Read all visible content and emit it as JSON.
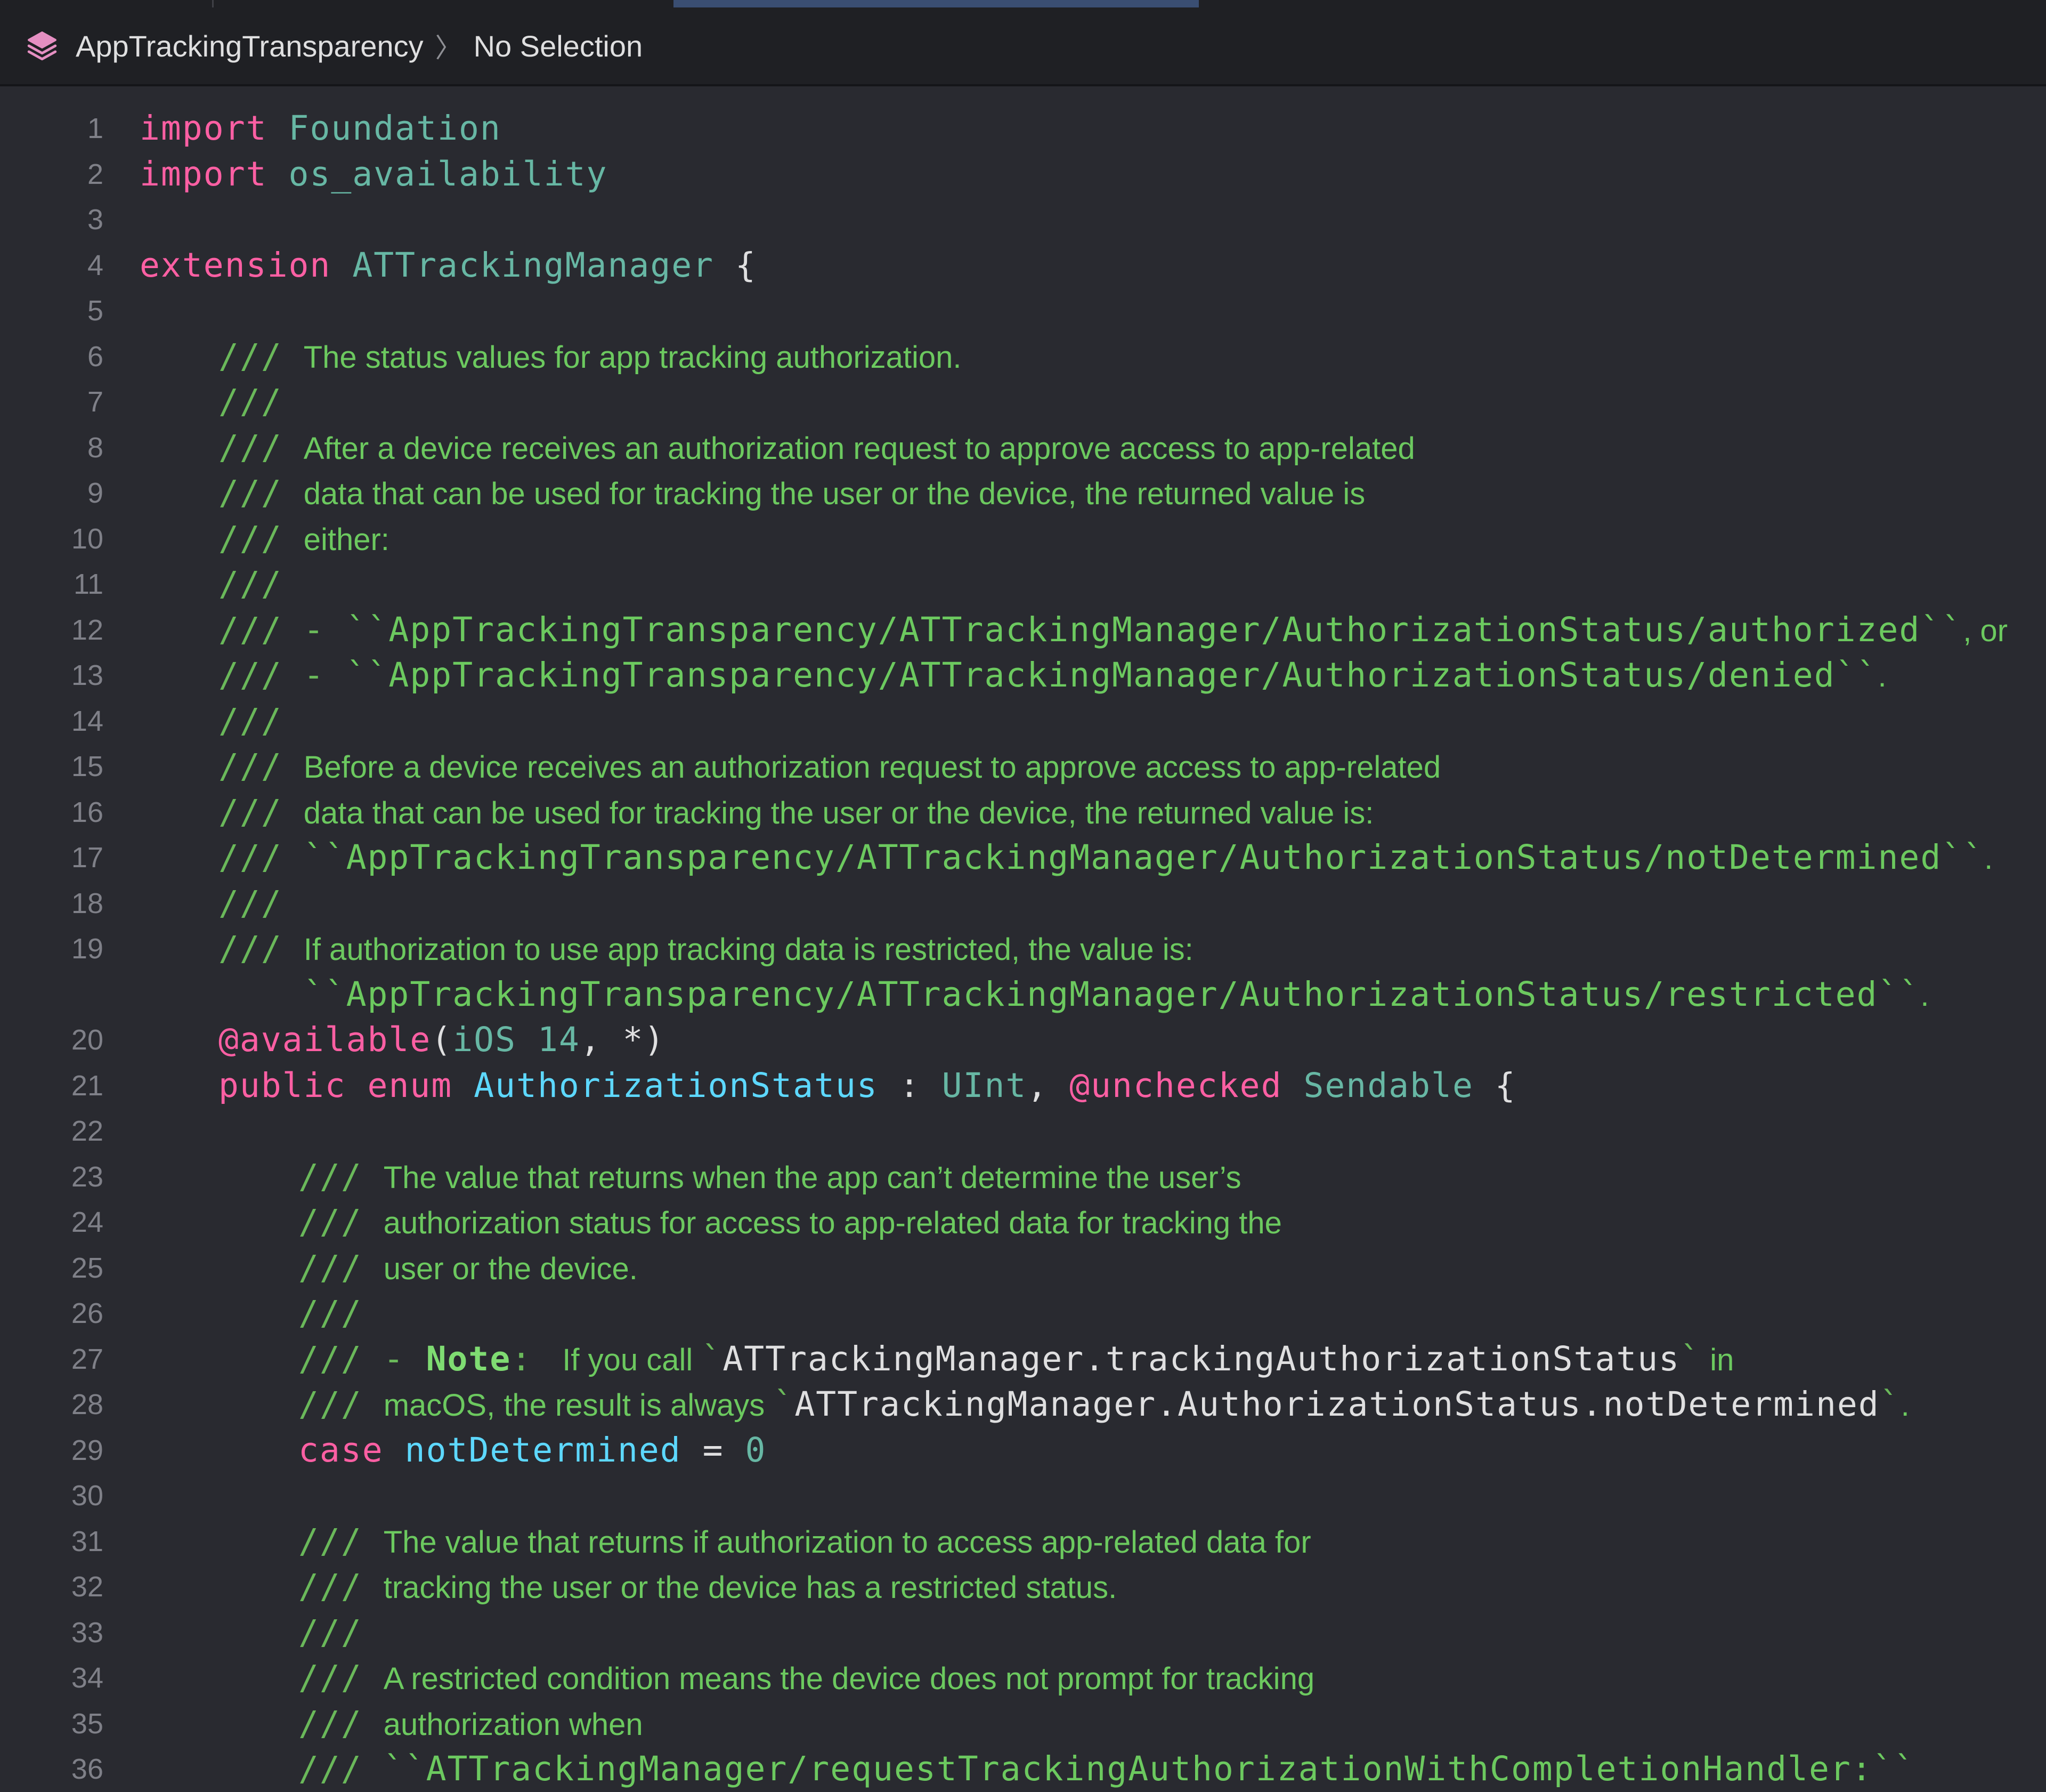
{
  "breadcrumb": {
    "module": "AppTrackingTransparency",
    "separator": "〉",
    "selection": "No Selection"
  },
  "icons": {
    "module_icon": "stack-layers-icon"
  },
  "colors": {
    "background": "#292a30",
    "keyword": "#fc5fa3",
    "type": "#5dd8ff",
    "doc_comment": "#6cc95f",
    "line_number": "#7f8088"
  },
  "lines": [
    {
      "n": "1",
      "segs": [
        [
          "kw",
          "import"
        ],
        [
          "plain",
          " "
        ],
        [
          "sy",
          "Foundation"
        ]
      ]
    },
    {
      "n": "2",
      "segs": [
        [
          "kw",
          "import"
        ],
        [
          "plain",
          " "
        ],
        [
          "sy",
          "os_availability"
        ]
      ]
    },
    {
      "n": "3",
      "segs": []
    },
    {
      "n": "4",
      "segs": [
        [
          "kw",
          "extension"
        ],
        [
          "plain",
          " "
        ],
        [
          "sy",
          "ATTrackingManager"
        ],
        [
          "plain",
          " {"
        ]
      ]
    },
    {
      "n": "5",
      "segs": []
    },
    {
      "n": "6",
      "indent": 1,
      "segs": [
        [
          "dc",
          "/// "
        ],
        [
          "dt",
          "The status values for app tracking authorization."
        ]
      ]
    },
    {
      "n": "7",
      "indent": 1,
      "segs": [
        [
          "dc",
          "///"
        ]
      ]
    },
    {
      "n": "8",
      "indent": 1,
      "segs": [
        [
          "dc",
          "/// "
        ],
        [
          "dt",
          "After a device receives an authorization request to approve access to app-related"
        ]
      ]
    },
    {
      "n": "9",
      "indent": 1,
      "segs": [
        [
          "dc",
          "/// "
        ],
        [
          "dt",
          "data that can be used for tracking the user or the device, the returned value is"
        ]
      ]
    },
    {
      "n": "10",
      "indent": 1,
      "segs": [
        [
          "dc",
          "/// "
        ],
        [
          "dt",
          "either:"
        ]
      ]
    },
    {
      "n": "11",
      "indent": 1,
      "segs": [
        [
          "dc",
          "///"
        ]
      ]
    },
    {
      "n": "12",
      "indent": 1,
      "segs": [
        [
          "dc",
          "/// - "
        ],
        [
          "dcode",
          "``AppTrackingTransparency/ATTrackingManager/AuthorizationStatus/authorized``"
        ],
        [
          "dt",
          ", or"
        ]
      ]
    },
    {
      "n": "13",
      "indent": 1,
      "segs": [
        [
          "dc",
          "/// - "
        ],
        [
          "dcode",
          "``AppTrackingTransparency/ATTrackingManager/AuthorizationStatus/denied``"
        ],
        [
          "dt",
          "."
        ]
      ]
    },
    {
      "n": "14",
      "indent": 1,
      "segs": [
        [
          "dc",
          "///"
        ]
      ]
    },
    {
      "n": "15",
      "indent": 1,
      "segs": [
        [
          "dc",
          "/// "
        ],
        [
          "dt",
          "Before a device receives an authorization request to approve access to app-related"
        ]
      ]
    },
    {
      "n": "16",
      "indent": 1,
      "segs": [
        [
          "dc",
          "/// "
        ],
        [
          "dt",
          "data that can be used for tracking the user or the device, the returned value is:"
        ]
      ]
    },
    {
      "n": "17",
      "indent": 1,
      "segs": [
        [
          "dc",
          "/// "
        ],
        [
          "dcode",
          "``AppTrackingTransparency/ATTrackingManager/AuthorizationStatus/notDetermined``"
        ],
        [
          "dt",
          "."
        ]
      ]
    },
    {
      "n": "18",
      "indent": 1,
      "segs": [
        [
          "dc",
          "///"
        ]
      ]
    },
    {
      "n": "19",
      "indent": 1,
      "segs": [
        [
          "dc",
          "/// "
        ],
        [
          "dt",
          "If authorization to use app tracking data is restricted, the value is:"
        ]
      ]
    },
    {
      "n": "",
      "indent": 1,
      "segs": [
        [
          "dc",
          "    "
        ],
        [
          "dcode",
          "``AppTrackingTransparency/ATTrackingManager/AuthorizationStatus/restricted``"
        ],
        [
          "dt",
          "."
        ]
      ]
    },
    {
      "n": "20",
      "indent": 1,
      "segs": [
        [
          "attr",
          "@available"
        ],
        [
          "plain",
          "("
        ],
        [
          "sy",
          "iOS"
        ],
        [
          "plain",
          " "
        ],
        [
          "num",
          "14"
        ],
        [
          "plain",
          ", *)"
        ]
      ]
    },
    {
      "n": "21",
      "indent": 1,
      "segs": [
        [
          "kw",
          "public"
        ],
        [
          "plain",
          " "
        ],
        [
          "kw",
          "enum"
        ],
        [
          "plain",
          " "
        ],
        [
          "ty",
          "AuthorizationStatus"
        ],
        [
          "plain",
          " : "
        ],
        [
          "sy",
          "UInt"
        ],
        [
          "plain",
          ", "
        ],
        [
          "attr",
          "@unchecked"
        ],
        [
          "plain",
          " "
        ],
        [
          "sy",
          "Sendable"
        ],
        [
          "plain",
          " {"
        ]
      ]
    },
    {
      "n": "22",
      "segs": []
    },
    {
      "n": "23",
      "indent": 2,
      "segs": [
        [
          "dc",
          "/// "
        ],
        [
          "dt",
          "The value that returns when the app can’t determine the user’s"
        ]
      ]
    },
    {
      "n": "24",
      "indent": 2,
      "segs": [
        [
          "dc",
          "/// "
        ],
        [
          "dt",
          "authorization status for access to app-related data for tracking the"
        ]
      ]
    },
    {
      "n": "25",
      "indent": 2,
      "segs": [
        [
          "dc",
          "/// "
        ],
        [
          "dt",
          "user or the device."
        ]
      ]
    },
    {
      "n": "26",
      "indent": 2,
      "segs": [
        [
          "dc",
          "///"
        ]
      ]
    },
    {
      "n": "27",
      "indent": 2,
      "segs": [
        [
          "dc",
          "/// - "
        ],
        [
          "bold",
          "Note"
        ],
        [
          "dc",
          ": "
        ],
        [
          "dt",
          " If you call "
        ],
        [
          "dc",
          "`"
        ],
        [
          "plain",
          "ATTrackingManager.trackingAuthorizationStatus"
        ],
        [
          "dc",
          "`"
        ],
        [
          "dt",
          " in"
        ]
      ]
    },
    {
      "n": "28",
      "indent": 2,
      "segs": [
        [
          "dc",
          "/// "
        ],
        [
          "dt",
          "macOS, the result is always "
        ],
        [
          "dc",
          "`"
        ],
        [
          "plain",
          "ATTrackingManager.AuthorizationStatus.notDetermined"
        ],
        [
          "dc",
          "`"
        ],
        [
          "dt",
          "."
        ]
      ]
    },
    {
      "n": "29",
      "indent": 2,
      "segs": [
        [
          "kw",
          "case"
        ],
        [
          "plain",
          " "
        ],
        [
          "ty",
          "notDetermined"
        ],
        [
          "plain",
          " = "
        ],
        [
          "num",
          "0"
        ]
      ]
    },
    {
      "n": "30",
      "segs": []
    },
    {
      "n": "31",
      "indent": 2,
      "segs": [
        [
          "dc",
          "/// "
        ],
        [
          "dt",
          "The value that returns if authorization to access app-related data for"
        ]
      ]
    },
    {
      "n": "32",
      "indent": 2,
      "segs": [
        [
          "dc",
          "/// "
        ],
        [
          "dt",
          "tracking the user or the device has a restricted status."
        ]
      ]
    },
    {
      "n": "33",
      "indent": 2,
      "segs": [
        [
          "dc",
          "///"
        ]
      ]
    },
    {
      "n": "34",
      "indent": 2,
      "segs": [
        [
          "dc",
          "/// "
        ],
        [
          "dt",
          "A restricted condition means the device does not prompt for tracking"
        ]
      ]
    },
    {
      "n": "35",
      "indent": 2,
      "segs": [
        [
          "dc",
          "/// "
        ],
        [
          "dt",
          "authorization when"
        ]
      ]
    },
    {
      "n": "36",
      "indent": 2,
      "segs": [
        [
          "dc",
          "/// "
        ],
        [
          "dcode",
          "``ATTrackingManager/requestTrackingAuthorizationWithCompletionHandler:``"
        ]
      ]
    }
  ]
}
